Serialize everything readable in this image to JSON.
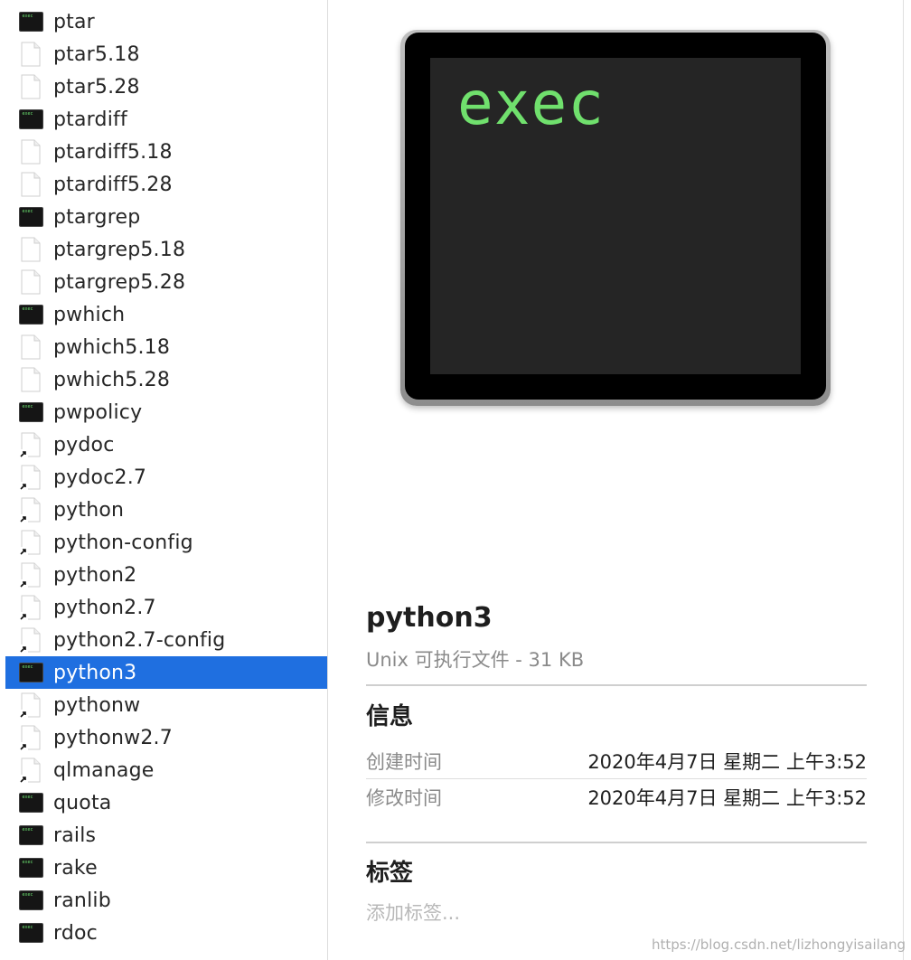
{
  "file_list": [
    {
      "name": "ptar",
      "icon": "exec-icon"
    },
    {
      "name": "ptar5.18",
      "icon": "doc-icon"
    },
    {
      "name": "ptar5.28",
      "icon": "doc-icon"
    },
    {
      "name": "ptardiff",
      "icon": "exec-icon"
    },
    {
      "name": "ptardiff5.18",
      "icon": "doc-icon"
    },
    {
      "name": "ptardiff5.28",
      "icon": "doc-icon"
    },
    {
      "name": "ptargrep",
      "icon": "exec-icon"
    },
    {
      "name": "ptargrep5.18",
      "icon": "doc-icon"
    },
    {
      "name": "ptargrep5.28",
      "icon": "doc-icon"
    },
    {
      "name": "pwhich",
      "icon": "exec-icon"
    },
    {
      "name": "pwhich5.18",
      "icon": "doc-icon"
    },
    {
      "name": "pwhich5.28",
      "icon": "doc-icon"
    },
    {
      "name": "pwpolicy",
      "icon": "exec-icon"
    },
    {
      "name": "pydoc",
      "icon": "alias-icon"
    },
    {
      "name": "pydoc2.7",
      "icon": "alias-icon"
    },
    {
      "name": "python",
      "icon": "alias-icon"
    },
    {
      "name": "python-config",
      "icon": "alias-icon"
    },
    {
      "name": "python2",
      "icon": "alias-icon"
    },
    {
      "name": "python2.7",
      "icon": "alias-icon"
    },
    {
      "name": "python2.7-config",
      "icon": "alias-icon"
    },
    {
      "name": "python3",
      "icon": "exec-icon",
      "selected": true
    },
    {
      "name": "pythonw",
      "icon": "alias-icon"
    },
    {
      "name": "pythonw2.7",
      "icon": "alias-icon"
    },
    {
      "name": "qlmanage",
      "icon": "alias-icon"
    },
    {
      "name": "quota",
      "icon": "exec-icon"
    },
    {
      "name": "rails",
      "icon": "exec-icon"
    },
    {
      "name": "rake",
      "icon": "exec-icon"
    },
    {
      "name": "ranlib",
      "icon": "exec-icon"
    },
    {
      "name": "rdoc",
      "icon": "exec-icon"
    }
  ],
  "preview": {
    "icon_text": "exec",
    "file_name": "python3",
    "file_kind": "Unix 可执行文件 - 31 KB",
    "info_title": "信息",
    "created_label": "创建时间",
    "created_value": "2020年4月7日 星期二 上午3:52",
    "modified_label": "修改时间",
    "modified_value": "2020年4月7日 星期二 上午3:52",
    "tags_title": "标签",
    "add_tags": "添加标签..."
  },
  "watermark": "https://blog.csdn.net/lizhongyisailang",
  "colors": {
    "selection": "#1f6fe0",
    "terminal_green": "#70e06d"
  }
}
